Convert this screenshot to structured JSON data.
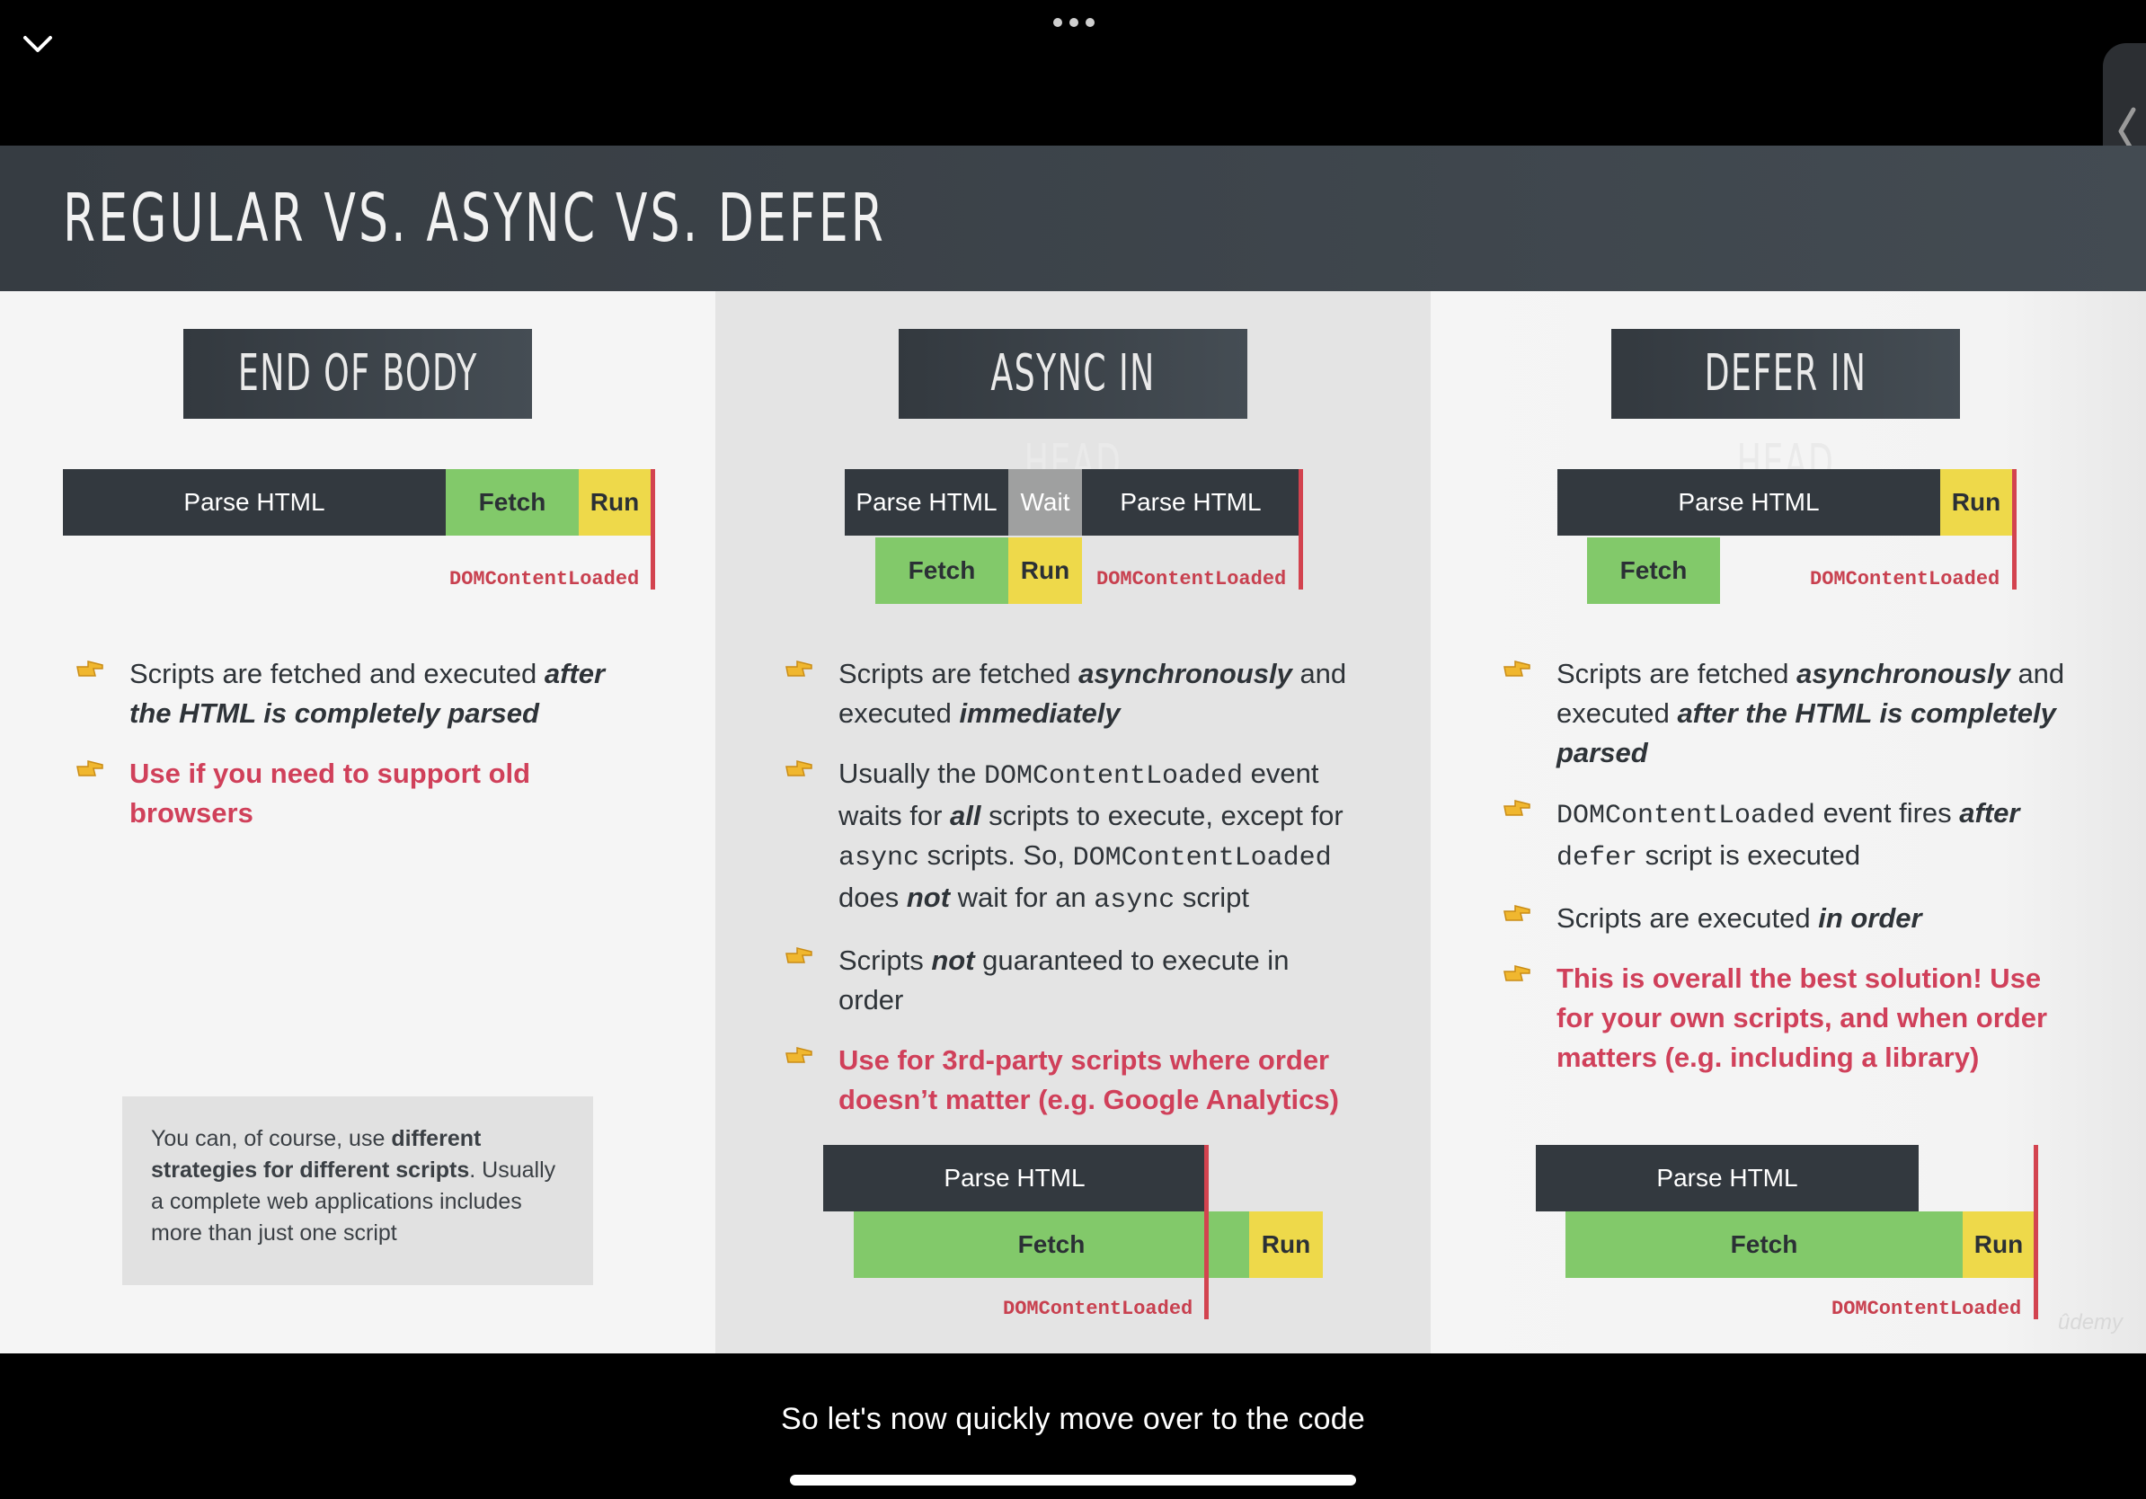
{
  "player": {
    "collapse_icon": "chevron-down-icon",
    "more_icon": "more-dots-icon",
    "side_panel_icon": "chevron-left-icon",
    "caption": "So let's now quickly move over to the code"
  },
  "slide": {
    "title": "REGULAR VS. ASYNC VS. DEFER",
    "watermark": "ûdemy",
    "dom_content_loaded": "DOMContentLoaded",
    "columns": [
      {
        "heading": "END OF BODY",
        "timeline": {
          "parse": "Parse HTML",
          "fetch": "Fetch",
          "run": "Run"
        },
        "bullets": {
          "b1_pre": "Scripts are fetched and executed ",
          "b1_em": "after the HTML is completely parsed",
          "b2": "Use if you need to support old browsers"
        },
        "note": {
          "pre": "You can, of course, use ",
          "bold": "different strategies for different scripts",
          "post": ". Usually a complete web applications includes more than just one script"
        }
      },
      {
        "heading": "ASYNC IN HEAD",
        "timeline": {
          "parse1": "Parse HTML",
          "wait": "Wait",
          "parse2": "Parse HTML",
          "fetch": "Fetch",
          "run": "Run"
        },
        "timeline2": {
          "parse": "Parse HTML",
          "fetch": "Fetch",
          "run": "Run"
        },
        "bullets": {
          "b1_pre": "Scripts are fetched ",
          "b1_em1": "asynchronously",
          "b1_mid": " and executed ",
          "b1_em2": "immediately",
          "b2_a": "Usually the ",
          "b2_code1": "DOMContentLoaded",
          "b2_b": " event waits for ",
          "b2_em": "all",
          "b2_c": " scripts to execute, except for ",
          "b2_code2": "async",
          "b2_d": " scripts. So, ",
          "b2_code3": "DOMContentLoaded",
          "b2_e": " does ",
          "b2_em2": "not",
          "b2_f": " wait for an ",
          "b2_code4": "async",
          "b2_g": " script",
          "b3_pre": "Scripts ",
          "b3_em": "not",
          "b3_post": " guaranteed to execute in order",
          "b4": "Use for 3rd-party scripts where order doesn’t matter (e.g. Google Analytics)"
        }
      },
      {
        "heading": "DEFER IN HEAD",
        "timeline": {
          "parse": "Parse HTML",
          "run": "Run",
          "fetch": "Fetch"
        },
        "timeline2": {
          "parse": "Parse HTML",
          "fetch": "Fetch",
          "run": "Run"
        },
        "bullets": {
          "b1_pre": "Scripts are fetched ",
          "b1_em1": "asynchronously",
          "b1_mid": " and executed ",
          "b1_em2": "after the HTML is completely parsed",
          "b2_code1": "DOMContentLoaded",
          "b2_a": " event fires ",
          "b2_em": "after",
          "b2_code2": "defer",
          "b2_b": " script is executed",
          "b3_pre": "Scripts are executed ",
          "b3_em": "in order",
          "b4": "This is overall the best solution! Use for your own scripts, and when order matters (e.g. including a library)"
        }
      }
    ]
  }
}
